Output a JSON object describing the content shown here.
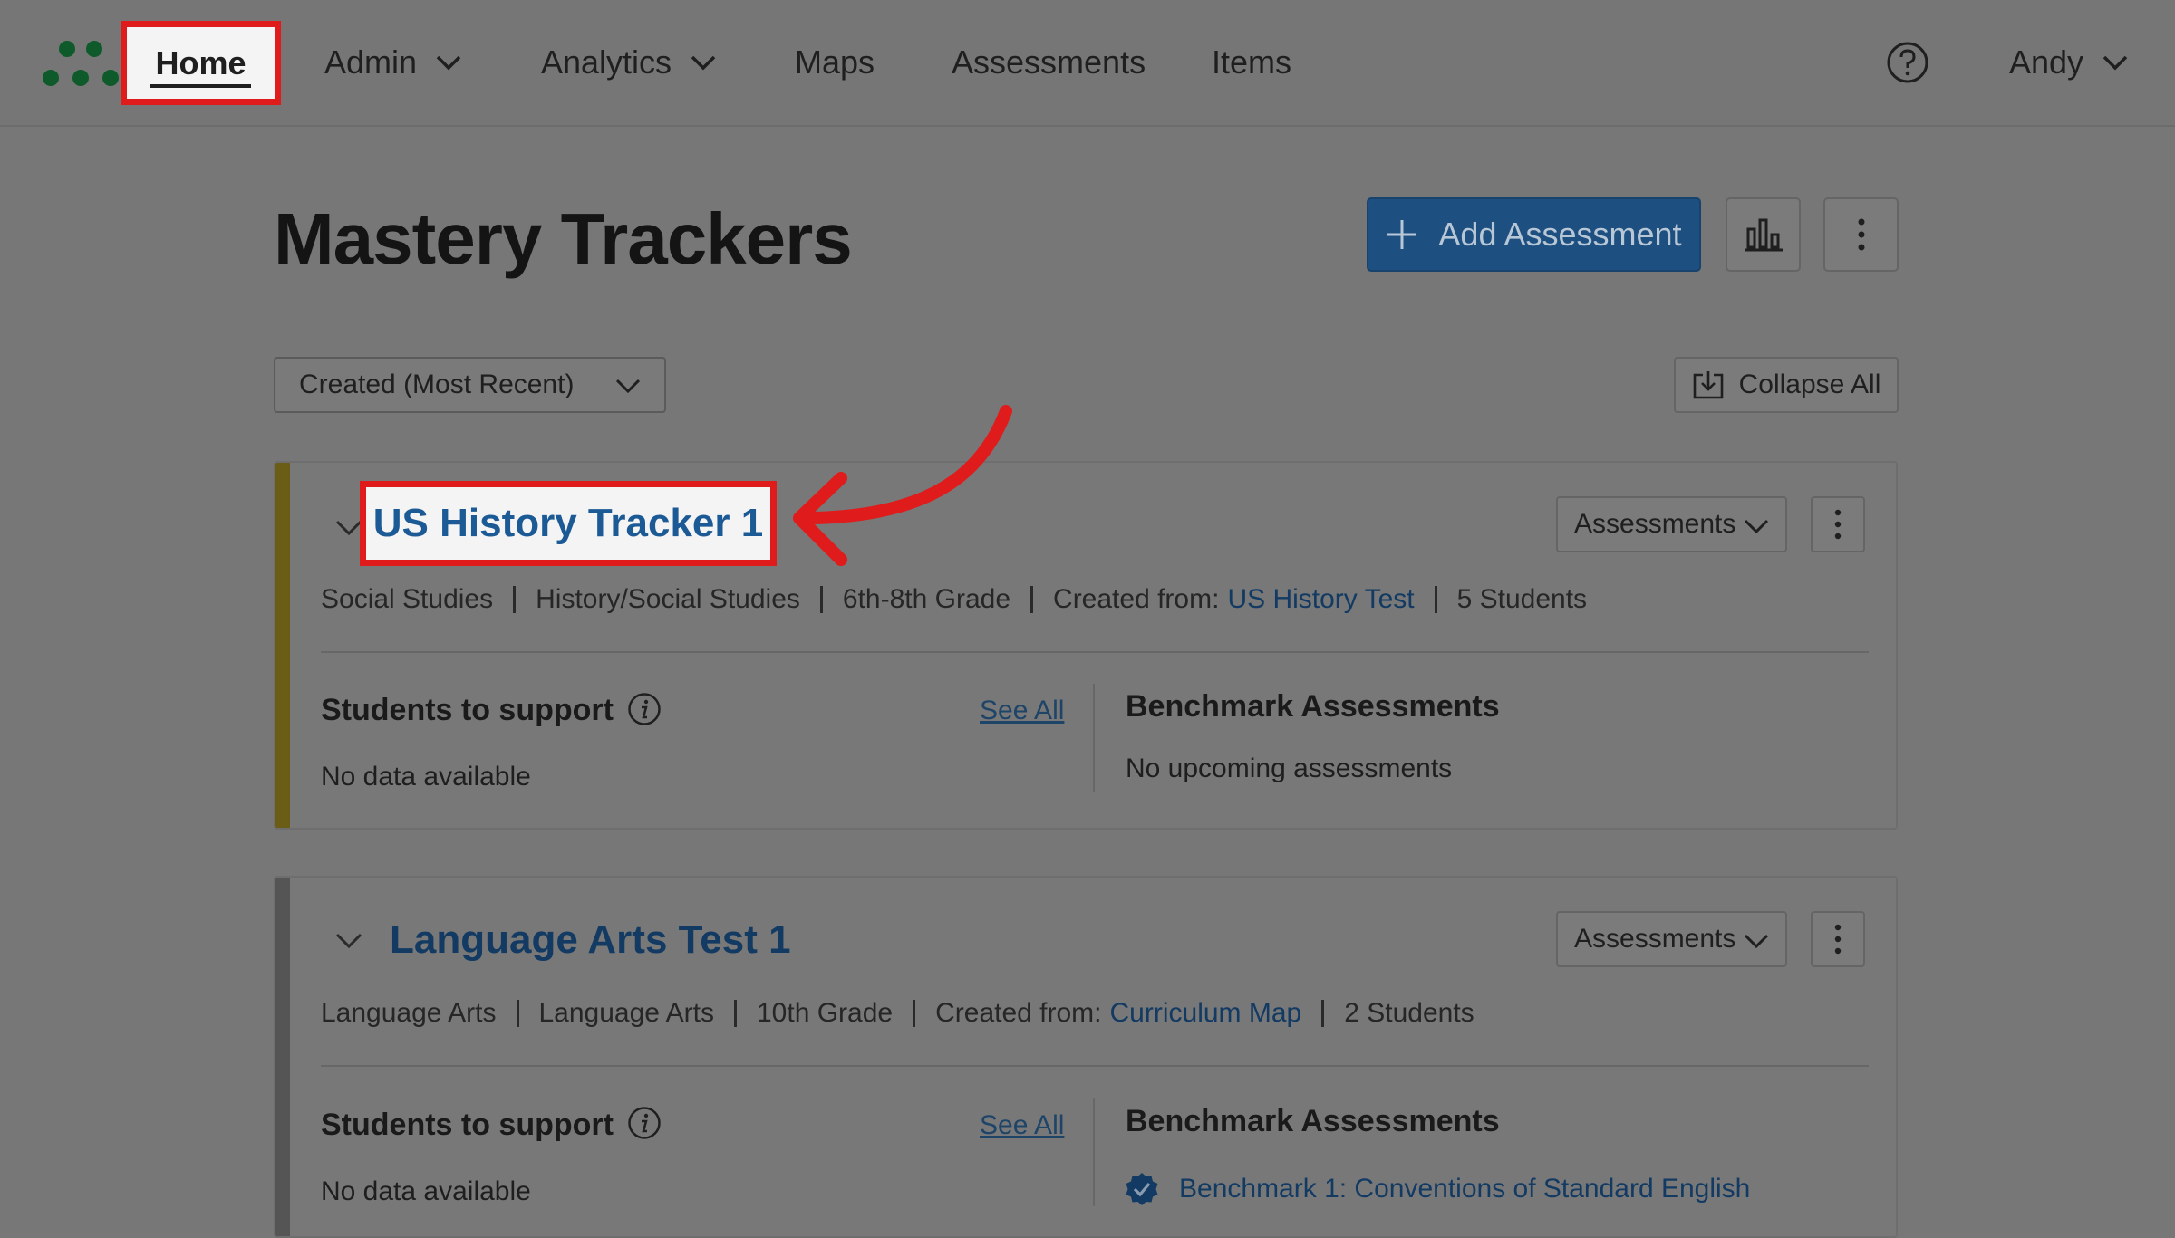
{
  "nav": {
    "items": [
      {
        "label": "Home"
      },
      {
        "label": "Admin"
      },
      {
        "label": "Analytics"
      },
      {
        "label": "Maps"
      },
      {
        "label": "Assessments"
      },
      {
        "label": "Items"
      }
    ],
    "user": "Andy"
  },
  "header": {
    "title": "Mastery Trackers",
    "add_label": "Add Assessment",
    "sort_value": "Created (Most Recent)",
    "collapse_label": "Collapse All"
  },
  "colors": {
    "annotation": "#e01b1b",
    "primary": "#1d4f80",
    "stripe_1": "#6b5d16",
    "stripe_2": "#555555"
  },
  "trackers": [
    {
      "title": "US History Tracker 1",
      "assessments_label": "Assessments",
      "meta": {
        "subject": "Social Studies",
        "course": "History/Social Studies",
        "grade": "6th-8th Grade",
        "created_prefix": "Created from:",
        "created_link": "US History Test",
        "students": "5 Students"
      },
      "support_heading": "Students to support",
      "see_all": "See All",
      "support_text": "No data available",
      "bench_heading": "Benchmark Assessments",
      "bench_text": "No upcoming assessments"
    },
    {
      "title": "Language Arts Test 1",
      "assessments_label": "Assessments",
      "meta": {
        "subject": "Language Arts",
        "course": "Language Arts",
        "grade": "10th Grade",
        "created_prefix": "Created from:",
        "created_link": "Curriculum Map",
        "students": "2 Students"
      },
      "support_heading": "Students to support",
      "see_all": "See All",
      "support_text": "No data available",
      "bench_heading": "Benchmark Assessments",
      "bench_link": "Benchmark 1: Conventions of Standard English"
    }
  ]
}
